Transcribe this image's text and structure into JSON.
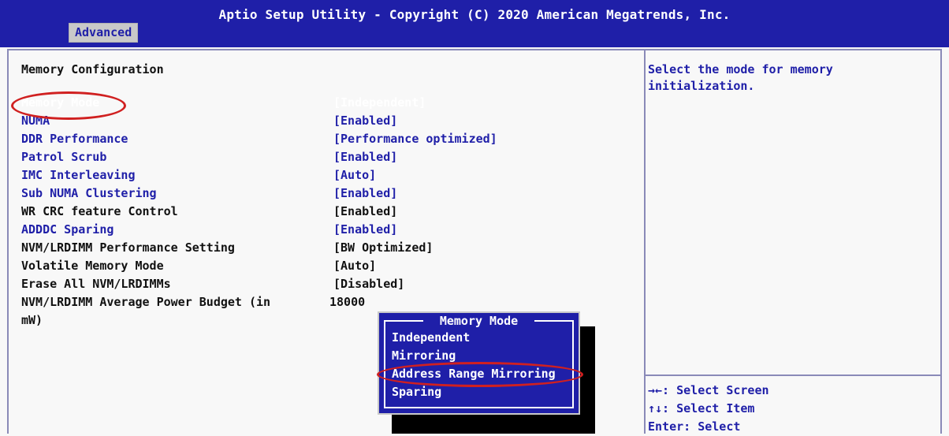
{
  "header": {
    "title": "Aptio Setup Utility - Copyright (C) 2020 American Megatrends, Inc.",
    "tab": "Advanced"
  },
  "section_title": "Memory Configuration",
  "settings": [
    {
      "label": "Memory Mode",
      "value": "[Independent]"
    },
    {
      "label": "NUMA",
      "value": "[Enabled]"
    },
    {
      "label": "DDR Performance",
      "value": "[Performance optimized]"
    },
    {
      "label": "Patrol Scrub",
      "value": "[Enabled]"
    },
    {
      "label": "IMC Interleaving",
      "value": "[Auto]"
    },
    {
      "label": "Sub NUMA Clustering",
      "value": "[Enabled]"
    },
    {
      "label": "WR CRC feature Control",
      "value": "[Enabled]"
    },
    {
      "label": "ADDDC Sparing",
      "value": "[Enabled]"
    },
    {
      "label": "NVM/LRDIMM Performance Setting",
      "value": "[BW Optimized]"
    },
    {
      "label": "Volatile Memory Mode",
      "value": "[Auto]"
    },
    {
      "label": "Erase All NVM/LRDIMMs",
      "value": "[Disabled]"
    },
    {
      "label": "NVM/LRDIMM Average Power Budget (in",
      "value": "18000"
    },
    {
      "label": "mW)",
      "value": ""
    }
  ],
  "help": {
    "text": "Select the mode for memory initialization."
  },
  "keys": [
    "→←: Select Screen",
    "↑↓: Select Item",
    "Enter: Select"
  ],
  "popup": {
    "title": "Memory Mode",
    "options": [
      "Independent",
      "Mirroring",
      "Address Range Mirroring",
      "Sparing"
    ]
  },
  "colors": {
    "bios_blue": "#1f1fa8",
    "highlight_red": "#d02020",
    "background": "#f8f8f8"
  }
}
